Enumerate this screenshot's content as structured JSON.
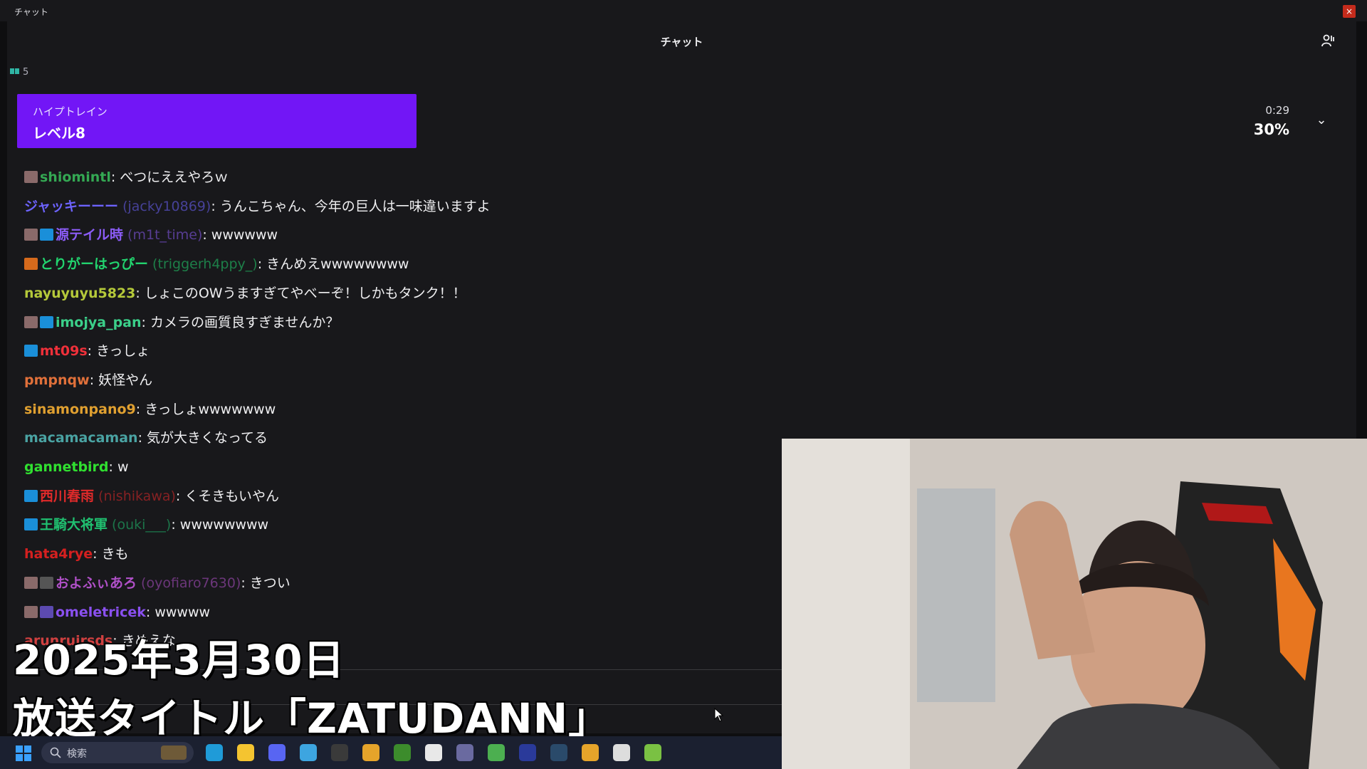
{
  "window": {
    "title": "チャット",
    "close_glyph": "×"
  },
  "chat": {
    "header_title": "チャット",
    "viewer_count": "5",
    "icons": {
      "users": "users-icon",
      "viewer": "viewer-icon"
    }
  },
  "hype_train": {
    "label": "ハイプトレイン",
    "level": "レベル8",
    "time_left": "0:29",
    "percent": "30%",
    "progress": 0.3,
    "chevron": "⌄",
    "color": "#7216f6"
  },
  "messages": [
    {
      "badges": [
        "sub"
      ],
      "user": "shiomintl",
      "login": "",
      "text": ": べつにええやろｗ",
      "color": "#34a853"
    },
    {
      "badges": [],
      "user": "ジャッキーーー",
      "login": " (jacky10869)",
      "text": ": うんこちゃん、今年の巨人は一味違いますよ",
      "color": "#6d63ff"
    },
    {
      "badges": [
        "sub",
        "prime"
      ],
      "user": "源テイル時",
      "login": " (m1t_time)",
      "text": ": wwwwww",
      "color": "#8b5cf6"
    },
    {
      "badges": [
        "fire"
      ],
      "user": "とりがーはっぴー",
      "login": " (triggerh4ppy_)",
      "text": ": きんめえwwwwwwww",
      "color": "#22d36e"
    },
    {
      "badges": [],
      "user": "nayuyuyu5823",
      "login": "",
      "text": ": しょこのOWうますぎてやべーぞ！しかもタンク！！",
      "color": "#b5c93a"
    },
    {
      "badges": [
        "sub",
        "prime"
      ],
      "user": "imojya_pan",
      "login": "",
      "text": ": カメラの画質良すぎませんか？",
      "color": "#3bd08a"
    },
    {
      "badges": [
        "prime"
      ],
      "user": "mt09s",
      "login": "",
      "text": ": きっしょ",
      "color": "#f0303a"
    },
    {
      "badges": [],
      "user": "pmpnqw",
      "login": "",
      "text": ": 妖怪やん",
      "color": "#e0703a"
    },
    {
      "badges": [],
      "user": "sinamonpano9",
      "login": "",
      "text": ": きっしょwwwwwww",
      "color": "#e0a030"
    },
    {
      "badges": [],
      "user": "macamacaman",
      "login": "",
      "text": ": 気が大きくなってる",
      "color": "#4aa3a3"
    },
    {
      "badges": [],
      "user": "gannetbird",
      "login": "",
      "text": ": w",
      "color": "#30e030"
    },
    {
      "badges": [
        "prime"
      ],
      "user": "西川春雨",
      "login": " (nishikawa)",
      "text": ": くそきもいやん",
      "color": "#e02a2a"
    },
    {
      "badges": [
        "prime"
      ],
      "user": "王騎大将軍",
      "login": " (ouki___)",
      "text": ": wwwwwwww",
      "color": "#20c070"
    },
    {
      "badges": [],
      "user": "hata4rye",
      "login": "",
      "text": ": きも",
      "color": "#d52020"
    },
    {
      "badges": [
        "sub",
        "gray"
      ],
      "user": "およふぃあろ",
      "login": " (oyofiaro7630)",
      "text": ": きつい",
      "color": "#b050c8"
    },
    {
      "badges": [
        "sub",
        "vip"
      ],
      "user": "omeletricek",
      "login": "",
      "text": ": wwwww",
      "color": "#8a50f0"
    },
    {
      "badges": [],
      "user": "arunruirsds",
      "login": "",
      "text": ": きめえな",
      "color": "#d04040"
    }
  ],
  "overlay": {
    "date": "2025年3月30日",
    "broadcast_title": "放送タイトル「ZATUDANN」"
  },
  "taskbar": {
    "search_placeholder": "検索",
    "apps": [
      {
        "name": "edge-icon",
        "color": "#1f9bd8"
      },
      {
        "name": "file-explorer-icon",
        "color": "#f4c430"
      },
      {
        "name": "discord-icon",
        "color": "#5865f2"
      },
      {
        "name": "notepad-icon",
        "color": "#3da5e0"
      },
      {
        "name": "obs-icon",
        "color": "#3a3a3a"
      },
      {
        "name": "chrome-icon",
        "color": "#e6a42a"
      },
      {
        "name": "minecraft-icon",
        "color": "#3c8c2c"
      },
      {
        "name": "capcut-icon",
        "color": "#e8e8e8"
      },
      {
        "name": "keyboard-icon",
        "color": "#6a6aa0"
      },
      {
        "name": "drive-icon",
        "color": "#4caf50"
      },
      {
        "name": "monitor-icon",
        "color": "#2a3a9a"
      },
      {
        "name": "steam-icon",
        "color": "#2a4a6a"
      },
      {
        "name": "chrome-2-icon",
        "color": "#e6a42a"
      },
      {
        "name": "unreal-icon",
        "color": "#dddddd"
      },
      {
        "name": "media-player-icon",
        "color": "#7ac143"
      }
    ]
  }
}
